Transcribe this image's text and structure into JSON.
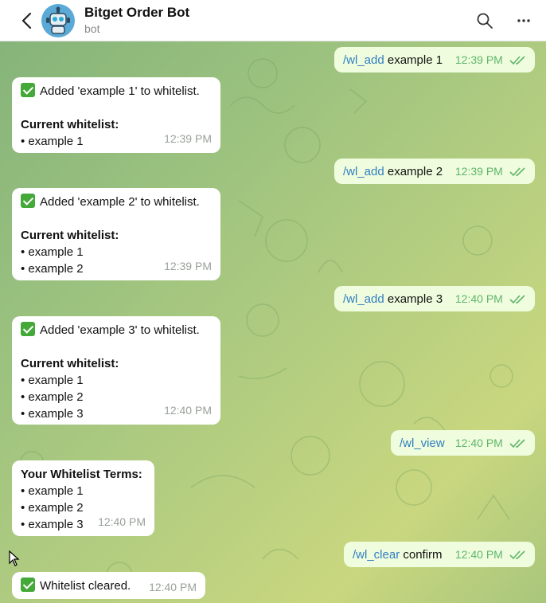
{
  "header": {
    "title": "Bitget Order Bot",
    "subtitle": "bot",
    "icons": {
      "back": "back-arrow-icon",
      "search": "search-icon",
      "more": "more-vertical-icon",
      "avatar": "robot-avatar-icon"
    }
  },
  "messages": [
    {
      "dir": "out",
      "command": "/wl_add",
      "text": " example 1",
      "time": "12:39 PM"
    },
    {
      "dir": "in",
      "status": "Added 'example 1' to whitelist.",
      "heading": "Current whitelist:",
      "items": [
        "• example 1"
      ],
      "time": "12:39 PM"
    },
    {
      "dir": "out",
      "command": "/wl_add",
      "text": " example 2",
      "time": "12:39 PM"
    },
    {
      "dir": "in",
      "status": "Added 'example 2' to whitelist.",
      "heading": "Current whitelist:",
      "items": [
        "• example 1",
        "• example 2"
      ],
      "time": "12:39 PM"
    },
    {
      "dir": "out",
      "command": "/wl_add",
      "text": " example 3",
      "time": "12:40 PM"
    },
    {
      "dir": "in",
      "status": "Added 'example 3' to whitelist.",
      "heading": "Current whitelist:",
      "items": [
        "• example 1",
        "• example 2",
        "• example 3"
      ],
      "time": "12:40 PM"
    },
    {
      "dir": "out",
      "command": "/wl_view",
      "text": "",
      "time": "12:40 PM"
    },
    {
      "dir": "in",
      "heading": "Your Whitelist Terms:",
      "items": [
        "• example 1",
        "• example 2",
        "• example 3"
      ],
      "time": "12:40 PM"
    },
    {
      "dir": "out",
      "command": "/wl_clear",
      "text": " confirm",
      "time": "12:40 PM"
    },
    {
      "dir": "in",
      "status": "Whitelist cleared.",
      "time": "12:40 PM"
    }
  ],
  "colors": {
    "accent": "#2f7dc0",
    "outgoing_bubble": "#effdde",
    "incoming_bubble": "#ffffff",
    "check_green": "#44a938",
    "read_ticks": "#5fb56a"
  }
}
